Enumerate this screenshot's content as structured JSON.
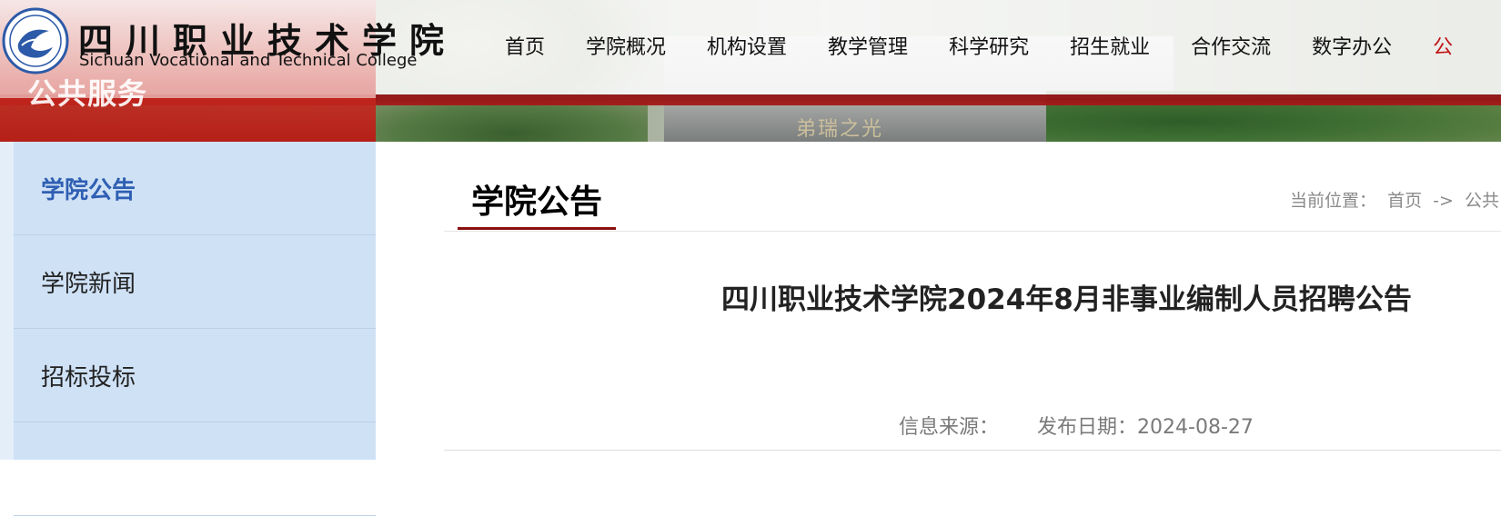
{
  "header": {
    "site_name_cn": "四川职业技术学院",
    "site_name_en": "Sichuan Vocational and Technical College",
    "section_ghost": "公共服务",
    "banner_inscription": "弟瑞之光"
  },
  "nav": [
    {
      "label": "首页"
    },
    {
      "label": "学院概况"
    },
    {
      "label": "机构设置"
    },
    {
      "label": "教学管理"
    },
    {
      "label": "科学研究"
    },
    {
      "label": "招生就业"
    },
    {
      "label": "合作交流"
    },
    {
      "label": "数字办公"
    },
    {
      "label": "公"
    }
  ],
  "sidebar": {
    "items": [
      {
        "label": "学院公告",
        "active": true
      },
      {
        "label": "学院新闻",
        "active": false
      },
      {
        "label": "招标投标",
        "active": false
      },
      {
        "label": "",
        "active": false
      }
    ]
  },
  "main": {
    "title": "学院公告",
    "breadcrumb": {
      "label": "当前位置：",
      "home": "首页",
      "sep": "->",
      "current": "公共"
    },
    "article": {
      "title": "四川职业技术学院2024年8月非事业编制人员招聘公告",
      "source_label": "信息来源：",
      "source_value": "",
      "date_label": "发布日期：",
      "date_value": "2024-08-27"
    }
  },
  "colors": {
    "brand_red": "#8a0f0f",
    "sidebar_bg": "#cfe1f5",
    "active_blue": "#2f5fb3"
  }
}
